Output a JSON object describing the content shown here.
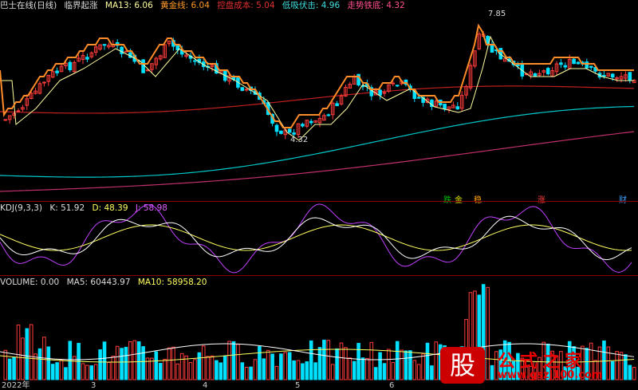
{
  "main_header": {
    "title": "巴士在线(日线)",
    "indicator": "临界起涨",
    "ma13_label": "MA13:",
    "ma13_value": "6.06",
    "gold_label": "黄金线:",
    "gold_value": "6.04",
    "cost_label": "控盘成本:",
    "cost_value": "5.04",
    "low_label": "低吸伏击:",
    "low_value": "4.96",
    "trend_label": "走势铁底:",
    "trend_value": "4.32"
  },
  "annotations": {
    "high": "7.85",
    "low": "4.32"
  },
  "signals": [
    {
      "text": "跌",
      "color": "#00c000"
    },
    {
      "text": "金",
      "color": "#e0e000"
    },
    {
      "text": "稳",
      "color": "#ffa000"
    },
    {
      "text": "涨",
      "color": "#ff4040"
    },
    {
      "text": "财",
      "color": "#40a0ff"
    }
  ],
  "kdj_header": {
    "name": "KDJ(9,3,3)",
    "k_label": "K:",
    "k_value": "51.92",
    "d_label": "D:",
    "d_value": "48.39",
    "j_label": "J:",
    "j_value": "58.98"
  },
  "vol_header": {
    "volume_label": "VOLUME:",
    "volume_value": "0.00",
    "ma5_label": "MA5:",
    "ma5_value": "60443.97",
    "ma10_label": "MA10:",
    "ma10_value": "58958.20"
  },
  "x_axis": [
    "2022年",
    "3",
    "4",
    "5",
    "6"
  ],
  "watermark": {
    "logo": "股",
    "text": "公式之家",
    "url": "www.gszj100.com"
  },
  "colors": {
    "up": "#ff3c3c",
    "down": "#00e0ff",
    "gold": "#ff8c28",
    "ma": "#ffffa0",
    "cost": "#c02020",
    "cyan": "#00c8c8",
    "pink": "#c0306a",
    "purple": "#c040ff"
  }
}
